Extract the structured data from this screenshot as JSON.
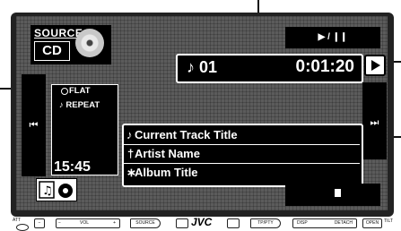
{
  "source": {
    "label": "SOURCE",
    "value": "CD"
  },
  "controls": {
    "play_pause": "▶ / ❙❙",
    "prev": "⏮",
    "next": "⏭"
  },
  "display": {
    "track_number": "♪ 01",
    "elapsed": "0:01:20"
  },
  "info": {
    "flat": "FLAT",
    "repeat": "♪ REPEAT",
    "clock": "15:45"
  },
  "track": {
    "title": "Current Track Title",
    "artist": "Artist Name",
    "album": "Album Title",
    "title_icon": "♪",
    "artist_icon": "†",
    "album_icon": "∗"
  },
  "hardware": {
    "att": "ATT",
    "minus": "−",
    "vol": "VOL",
    "plus": "+",
    "source_btn": "SOURCE",
    "brand": "JVC",
    "tp_pty": "TP/PTY",
    "disp": "DISP",
    "detach": "DETACH",
    "open": "OPEN",
    "tilt": "TILT"
  }
}
